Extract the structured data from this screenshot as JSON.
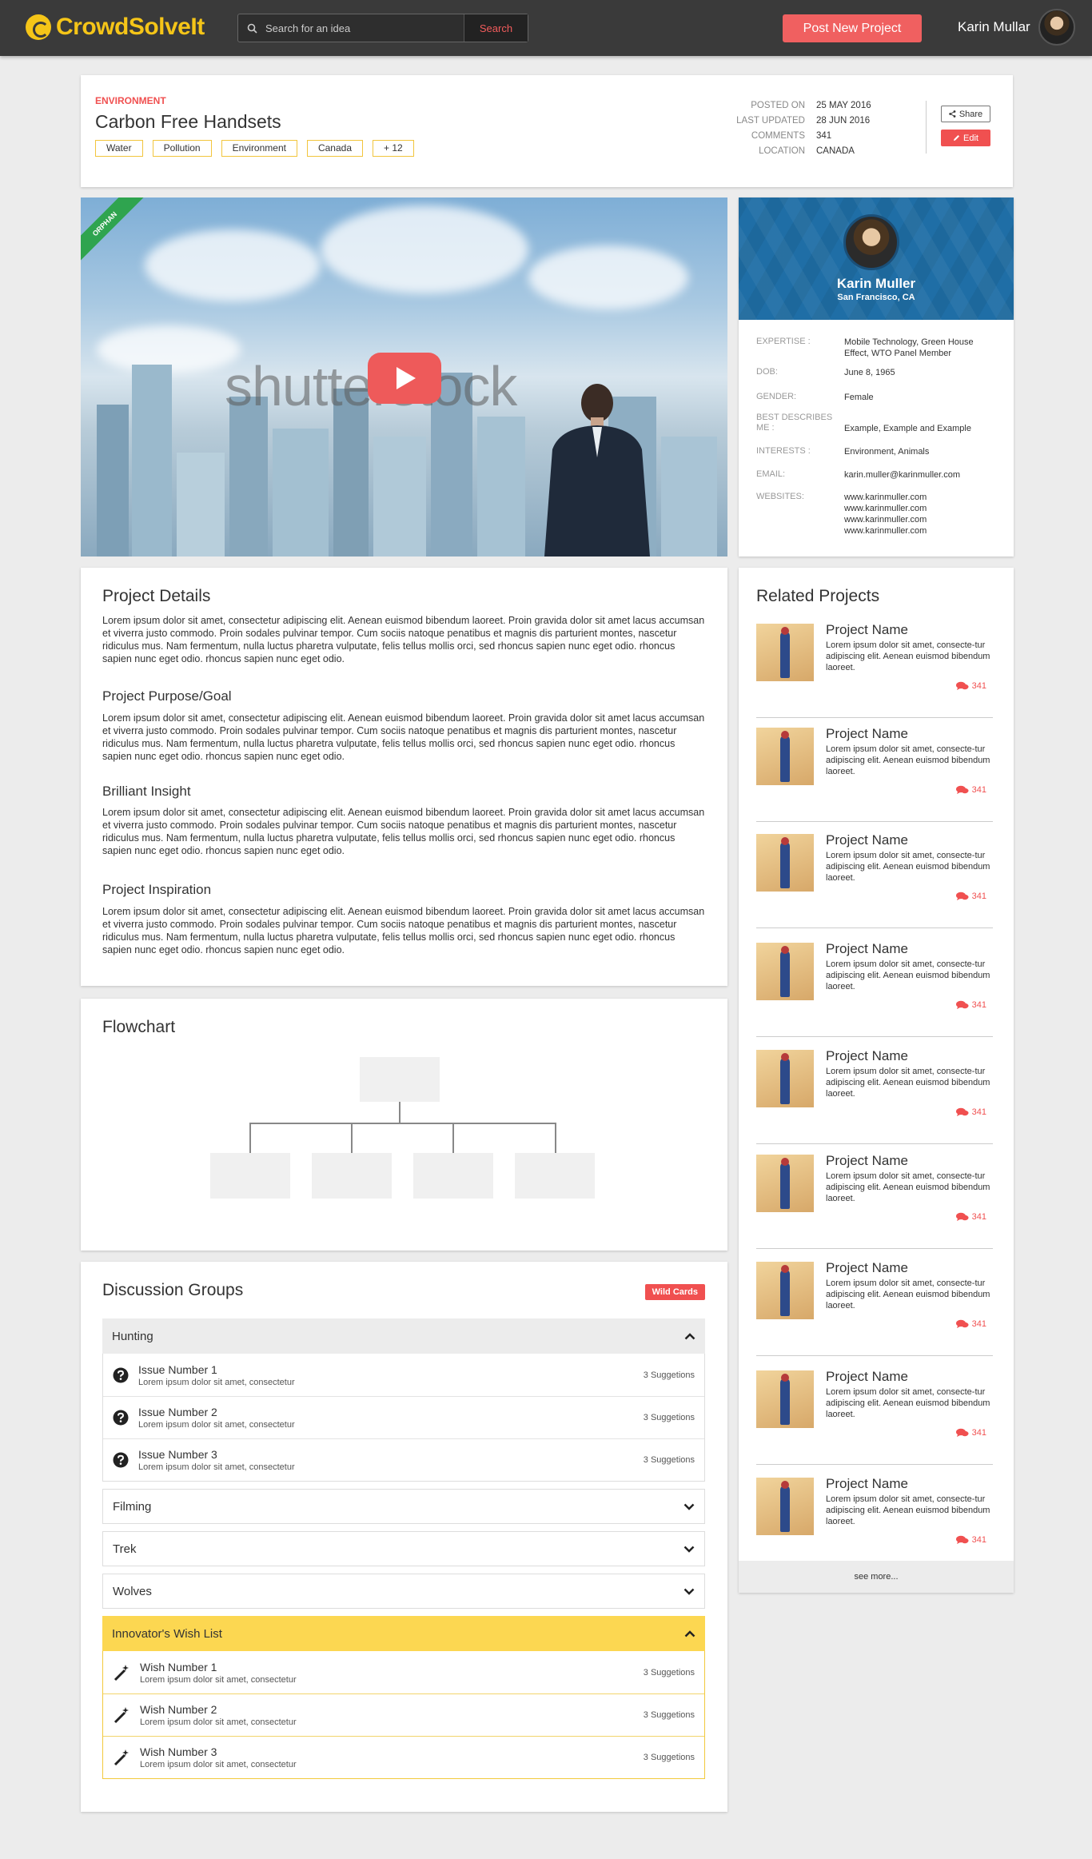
{
  "header": {
    "logo_text": "CrowdSolveIt",
    "search_placeholder": "Search for an idea",
    "search_button": "Search",
    "post_button": "Post New Project",
    "user_name": "Karin Mullar"
  },
  "project": {
    "category": "ENVIRONMENT",
    "title": "Carbon Free Handsets",
    "tags": [
      "Water",
      "Pollution",
      "Environment",
      "Canada",
      "+ 12"
    ],
    "meta": [
      {
        "label": "POSTED ON",
        "value": "25 MAY 2016"
      },
      {
        "label": "LAST UPDATED",
        "value": "28 JUN 2016"
      },
      {
        "label": "COMMENTS",
        "value": "341"
      },
      {
        "label": "LOCATION",
        "value": "CANADA"
      }
    ],
    "share_label": "Share",
    "edit_label": "Edit"
  },
  "video": {
    "ribbon": "ORPHAN",
    "watermark": "shutterstock"
  },
  "profile": {
    "name": "Karin Muller",
    "location": "San Francisco, CA",
    "fields": [
      {
        "label": "EXPERTISE :",
        "value": "Mobile Technology, Green House Effect, WTO Panel Member"
      },
      {
        "label": "DOB:",
        "value": "June 8, 1965"
      },
      {
        "label": "GENDER:",
        "value": "Female"
      },
      {
        "label": "BEST DESCRIBES ME :",
        "value": "Example, Example and Example"
      },
      {
        "label": "INTERESTS :",
        "value": "Environment, Animals"
      },
      {
        "label": "EMAIL:",
        "value": "karin.muller@karinmuller.com"
      },
      {
        "label": "WEBSITES:",
        "value": "www.karinmuller.com\nwww.karinmuller.com\nwww.karinmuller.com\nwww.karinmuller.com"
      }
    ]
  },
  "details": {
    "heading": "Project Details",
    "sections": [
      {
        "title": "",
        "body": "Lorem ipsum dolor sit amet, consectetur adipiscing elit. Aenean euismod bibendum laoreet. Proin gravida dolor sit amet lacus accumsan et viverra justo commodo. Proin sodales pulvinar tempor. Cum sociis natoque penatibus et magnis dis parturient montes, nascetur ridiculus mus. Nam fermentum, nulla luctus pharetra vulputate, felis tellus mollis orci, sed rhoncus sapien nunc eget odio. rhoncus sapien nunc eget odio. rhoncus sapien nunc eget odio."
      },
      {
        "title": "Project Purpose/Goal",
        "body": "Lorem ipsum dolor sit amet, consectetur adipiscing elit. Aenean euismod bibendum laoreet. Proin gravida dolor sit amet lacus accumsan et viverra justo commodo. Proin sodales pulvinar tempor. Cum sociis natoque penatibus et magnis dis parturient montes, nascetur ridiculus mus. Nam fermentum, nulla luctus pharetra vulputate, felis tellus mollis orci, sed rhoncus sapien nunc eget odio. rhoncus sapien nunc eget odio. rhoncus sapien nunc eget odio."
      },
      {
        "title": "Brilliant Insight",
        "body": "Lorem ipsum dolor sit amet, consectetur adipiscing elit. Aenean euismod bibendum laoreet. Proin gravida dolor sit amet lacus accumsan et viverra justo commodo. Proin sodales pulvinar tempor. Cum sociis natoque penatibus et magnis dis parturient montes, nascetur ridiculus mus. Nam fermentum, nulla luctus pharetra vulputate, felis tellus mollis orci, sed rhoncus sapien nunc eget odio. rhoncus sapien nunc eget odio. rhoncus sapien nunc eget odio."
      },
      {
        "title": "Project Inspiration",
        "body": "Lorem ipsum dolor sit amet, consectetur adipiscing elit. Aenean euismod bibendum laoreet. Proin gravida dolor sit amet lacus accumsan et viverra justo commodo. Proin sodales pulvinar tempor. Cum sociis natoque penatibus et magnis dis parturient montes, nascetur ridiculus mus. Nam fermentum, nulla luctus pharetra vulputate, felis tellus mollis orci, sed rhoncus sapien nunc eget odio. rhoncus sapien nunc eget odio. rhoncus sapien nunc eget odio."
      }
    ]
  },
  "flowchart": {
    "heading": "Flowchart"
  },
  "discussion": {
    "heading": "Discussion Groups",
    "wild_cards": "Wild Cards",
    "groups": [
      {
        "name": "Hunting",
        "open": true,
        "items": [
          {
            "title": "Issue Number 1",
            "sub": "Lorem ipsum dolor sit amet, consectetur",
            "count": "3 Suggetions"
          },
          {
            "title": "Issue Number 2",
            "sub": "Lorem ipsum dolor sit amet, consectetur",
            "count": "3 Suggetions"
          },
          {
            "title": "Issue Number 3",
            "sub": "Lorem ipsum dolor sit amet, consectetur",
            "count": "3 Suggetions"
          }
        ]
      },
      {
        "name": "Filming",
        "open": false
      },
      {
        "name": "Trek",
        "open": false
      },
      {
        "name": "Wolves",
        "open": false
      },
      {
        "name": "Innovator's Wish List",
        "open": true,
        "items": [
          {
            "title": "Wish Number 1",
            "sub": "Lorem ipsum dolor sit amet, consectetur",
            "count": "3 Suggetions"
          },
          {
            "title": "Wish Number 2",
            "sub": "Lorem ipsum dolor sit amet, consectetur",
            "count": "3 Suggetions"
          },
          {
            "title": "Wish Number 3",
            "sub": "Lorem ipsum dolor sit amet, consectetur",
            "count": "3 Suggetions"
          }
        ]
      }
    ]
  },
  "related": {
    "heading": "Related Projects",
    "items": [
      {
        "name": "Project Name",
        "desc": "Lorem ipsum dolor sit amet, consecte-tur adipiscing elit. Aenean euismod bibendum laoreet.",
        "comments": "341"
      },
      {
        "name": "Project Name",
        "desc": "Lorem ipsum dolor sit amet, consecte-tur adipiscing elit. Aenean euismod bibendum laoreet.",
        "comments": "341"
      },
      {
        "name": "Project Name",
        "desc": "Lorem ipsum dolor sit amet, consecte-tur adipiscing elit. Aenean euismod bibendum laoreet.",
        "comments": "341"
      },
      {
        "name": "Project Name",
        "desc": "Lorem ipsum dolor sit amet, consecte-tur adipiscing elit. Aenean euismod bibendum laoreet.",
        "comments": "341"
      },
      {
        "name": "Project Name",
        "desc": "Lorem ipsum dolor sit amet, consecte-tur adipiscing elit. Aenean euismod bibendum laoreet.",
        "comments": "341"
      },
      {
        "name": "Project Name",
        "desc": "Lorem ipsum dolor sit amet, consecte-tur adipiscing elit. Aenean euismod bibendum laoreet.",
        "comments": "341"
      },
      {
        "name": "Project Name",
        "desc": "Lorem ipsum dolor sit amet, consecte-tur adipiscing elit. Aenean euismod bibendum laoreet.",
        "comments": "341"
      },
      {
        "name": "Project Name",
        "desc": "Lorem ipsum dolor sit amet, consecte-tur adipiscing elit. Aenean euismod bibendum laoreet.",
        "comments": "341"
      },
      {
        "name": "Project Name",
        "desc": "Lorem ipsum dolor sit amet, consecte-tur adipiscing elit. Aenean euismod bibendum laoreet.",
        "comments": "341"
      }
    ],
    "see_more": "see more..."
  },
  "colors": {
    "accent": "#f05050",
    "brand": "#f5c518",
    "tag_border": "#f2c53d",
    "wish_header": "#fcd751",
    "profile_banner": "#1f6ea6"
  }
}
